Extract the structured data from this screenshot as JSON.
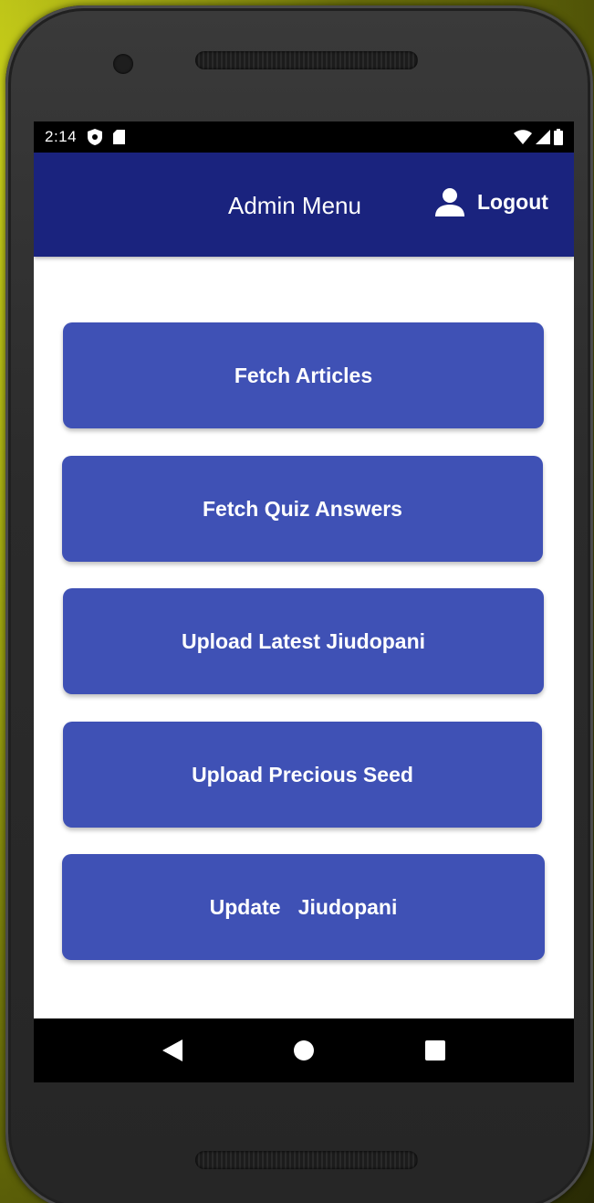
{
  "status_bar": {
    "time": "2:14",
    "icons": [
      "shield-icon",
      "sim-card-icon",
      "wifi-icon",
      "signal-icon",
      "battery-icon"
    ]
  },
  "app_bar": {
    "title": "Admin Menu",
    "logout_label": "Logout",
    "logout_icon": "person-icon",
    "background": "#1a237e"
  },
  "menu": {
    "button_color": "#3f51b5",
    "buttons": [
      {
        "label": "Fetch Articles"
      },
      {
        "label": "Fetch Quiz Answers"
      },
      {
        "label": "Upload Latest Jiudopani"
      },
      {
        "label": "Upload Precious Seed"
      },
      {
        "label": "Update   Jiudopani"
      }
    ]
  },
  "nav_bar": {
    "keys": [
      "back-icon",
      "home-icon",
      "recents-icon"
    ]
  }
}
